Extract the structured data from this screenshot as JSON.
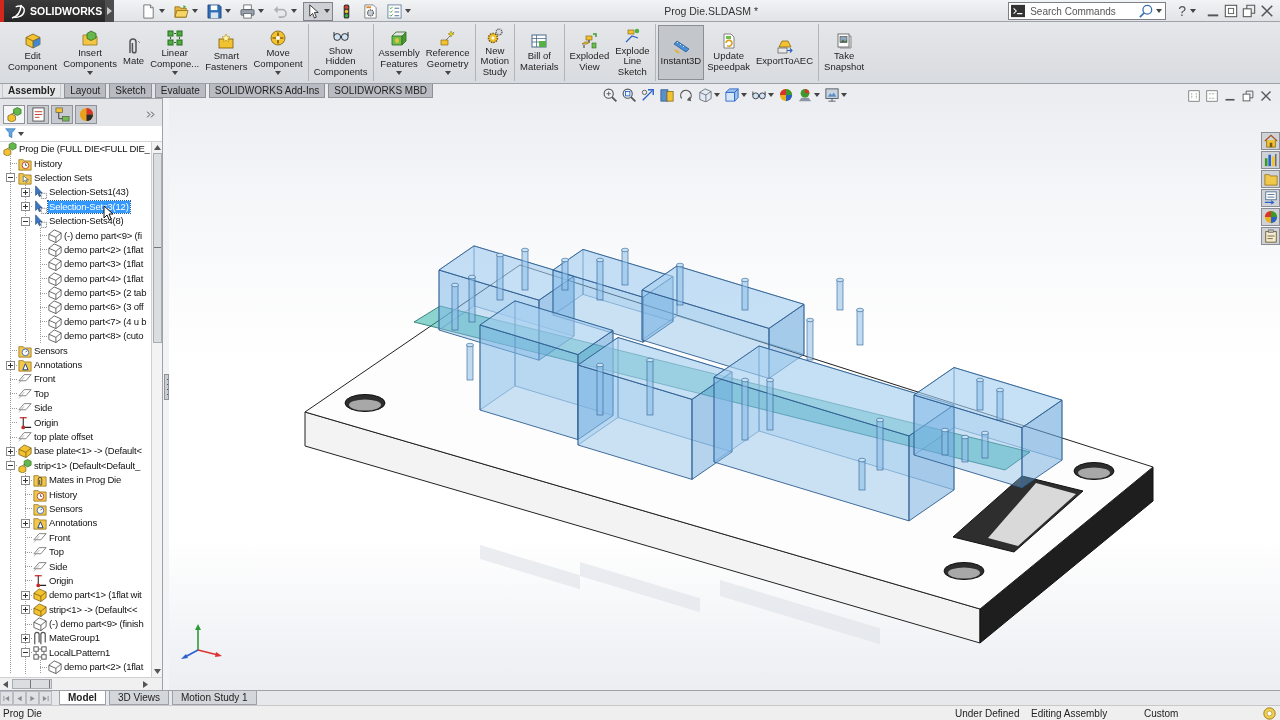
{
  "title_bar": {
    "logo": "SOLIDWORKS",
    "quick_access": [
      {
        "dropdown": true,
        "disabled": false,
        "pressed": false
      },
      {
        "dropdown": true,
        "disabled": false,
        "pressed": false
      },
      {
        "dropdown": true,
        "disabled": false,
        "pressed": false
      },
      {
        "dropdown": true,
        "disabled": false,
        "pressed": false
      },
      {
        "dropdown": true,
        "disabled": true,
        "pressed": false
      },
      {
        "dropdown": true,
        "disabled": false,
        "pressed": true
      },
      {
        "dropdown": false,
        "disabled": false,
        "pressed": false
      },
      {
        "dropdown": false,
        "disabled": false,
        "pressed": false
      },
      {
        "dropdown": true,
        "disabled": false,
        "pressed": false
      }
    ],
    "title": "Prog Die.SLDASM *",
    "search": {
      "placeholder": "Search Commands"
    },
    "help": "?"
  },
  "ribbon": {
    "groups": [
      [
        {
          "label": "Edit\nComponent",
          "dropdown": false,
          "pressed": false
        },
        {
          "label": "Insert\nComponents",
          "dropdown": true,
          "pressed": false
        },
        {
          "label": "Mate",
          "dropdown": false,
          "pressed": false
        },
        {
          "label": "Linear\nCompone...",
          "dropdown": true,
          "pressed": false
        },
        {
          "label": "Smart\nFasteners",
          "dropdown": false,
          "pressed": false
        },
        {
          "label": "Move\nComponent",
          "dropdown": true,
          "pressed": false
        }
      ],
      [
        {
          "label": "Show\nHidden\nComponents",
          "dropdown": false,
          "pressed": false
        }
      ],
      [
        {
          "label": "Assembly\nFeatures",
          "dropdown": true,
          "pressed": false
        },
        {
          "label": "Reference\nGeometry",
          "dropdown": true,
          "pressed": false
        }
      ],
      [
        {
          "label": "New\nMotion\nStudy",
          "dropdown": false,
          "pressed": false
        }
      ],
      [
        {
          "label": "Bill of\nMaterials",
          "dropdown": false,
          "pressed": false
        }
      ],
      [
        {
          "label": "Exploded\nView",
          "dropdown": false,
          "pressed": false
        },
        {
          "label": "Explode\nLine\nSketch",
          "dropdown": false,
          "pressed": false
        }
      ],
      [
        {
          "label": "Instant3D",
          "dropdown": false,
          "pressed": true
        },
        {
          "label": "Update\nSpeedpak",
          "dropdown": false,
          "pressed": false
        },
        {
          "label": "ExportToAEC",
          "dropdown": false,
          "pressed": false
        }
      ],
      [
        {
          "label": "Take\nSnapshot",
          "dropdown": false,
          "pressed": false
        }
      ]
    ]
  },
  "command_tabs": [
    {
      "label": "Assembly",
      "selected": true
    },
    {
      "label": "Layout",
      "selected": false
    },
    {
      "label": "Sketch",
      "selected": false
    },
    {
      "label": "Evaluate",
      "selected": false
    },
    {
      "label": "SOLIDWORKS Add-Ins",
      "selected": false
    },
    {
      "label": "SOLIDWORKS MBD",
      "selected": false
    }
  ],
  "panel": {
    "tabs": [
      {
        "selected": true
      },
      {
        "selected": false
      },
      {
        "selected": false
      },
      {
        "selected": false
      }
    ],
    "tree": [
      {
        "label": "Prog Die (FULL DIE<FULL DIE_",
        "kind": "assembly",
        "selected": false,
        "children": [
          {
            "label": "History",
            "kind": "history",
            "selected": false
          },
          {
            "label": "Selection Sets",
            "kind": "selection-folder",
            "selected": false,
            "expanded": true,
            "children": [
              {
                "label": "Selection-Sets1(43)",
                "kind": "selection-set",
                "selected": false,
                "expanded": false
              },
              {
                "label": "Selection-Sets3(12)",
                "kind": "selection-set",
                "selected": true,
                "expanded": false
              },
              {
                "label": "Selection-Sets4(8)",
                "kind": "selection-set",
                "selected": false,
                "expanded": true,
                "children": [
                  {
                    "label": "(-) demo part<9> (fi",
                    "kind": "part-reference",
                    "selected": false
                  },
                  {
                    "label": "demo part<2> (1flat",
                    "kind": "part-reference",
                    "selected": false
                  },
                  {
                    "label": "demo part<3> (1flat",
                    "kind": "part-reference",
                    "selected": false
                  },
                  {
                    "label": "demo part<4> (1flat",
                    "kind": "part-reference",
                    "selected": false
                  },
                  {
                    "label": "demo part<5> (2 tab",
                    "kind": "part-reference",
                    "selected": false
                  },
                  {
                    "label": "demo part<6> (3 off",
                    "kind": "part-reference",
                    "selected": false
                  },
                  {
                    "label": "demo part<7> (4 u b",
                    "kind": "part-reference",
                    "selected": false
                  },
                  {
                    "label": "demo part<8> (cuto",
                    "kind": "part-reference",
                    "selected": false
                  }
                ]
              }
            ]
          },
          {
            "label": "Sensors",
            "kind": "sensors",
            "selected": false
          },
          {
            "label": "Annotations",
            "kind": "annotations",
            "selected": false,
            "expanded": false
          },
          {
            "label": "Front",
            "kind": "plane",
            "selected": false
          },
          {
            "label": "Top",
            "kind": "plane",
            "selected": false
          },
          {
            "label": "Side",
            "kind": "plane",
            "selected": false
          },
          {
            "label": "Origin",
            "kind": "origin",
            "selected": false
          },
          {
            "label": "top plate offset",
            "kind": "plane",
            "selected": false
          },
          {
            "label": "base plate<1> -> (Default<",
            "kind": "part",
            "selected": false,
            "expanded": false
          },
          {
            "label": "strip<1> (Default<Default_",
            "kind": "subassembly",
            "selected": false,
            "expanded": true,
            "children": [
              {
                "label": "Mates in Prog Die",
                "kind": "mates-folder",
                "selected": false,
                "expanded": false
              },
              {
                "label": "History",
                "kind": "history",
                "selected": false
              },
              {
                "label": "Sensors",
                "kind": "sensors",
                "selected": false
              },
              {
                "label": "Annotations",
                "kind": "annotations",
                "selected": false,
                "expanded": false
              },
              {
                "label": "Front",
                "kind": "plane",
                "selected": false
              },
              {
                "label": "Top",
                "kind": "plane",
                "selected": false
              },
              {
                "label": "Side",
                "kind": "plane",
                "selected": false
              },
              {
                "label": "Origin",
                "kind": "origin",
                "selected": false
              },
              {
                "label": "demo part<1> (1flat wit",
                "kind": "part",
                "selected": false,
                "expanded": false
              },
              {
                "label": "strip<1> -> (Default<<",
                "kind": "part",
                "selected": false,
                "expanded": false
              },
              {
                "label": "(-) demo part<9> (finish",
                "kind": "part-reference",
                "selected": false
              },
              {
                "label": "MateGroup1",
                "kind": "mate-group",
                "selected": false,
                "expanded": false
              },
              {
                "label": "LocalLPattern1",
                "kind": "pattern",
                "selected": false,
                "expanded": true,
                "children": [
                  {
                    "label": "demo part<2> (1flat",
                    "kind": "part-reference",
                    "selected": false
                  }
                ]
              }
            ]
          }
        ]
      }
    ]
  },
  "bottom_tabs": [
    {
      "label": "Model",
      "selected": true
    },
    {
      "label": "3D Views",
      "selected": false
    },
    {
      "label": "Motion Study 1",
      "selected": false
    }
  ],
  "status_bar": {
    "document": "Prog Die",
    "fields": [
      "Under Defined",
      "Editing Assembly",
      "Custom"
    ]
  }
}
